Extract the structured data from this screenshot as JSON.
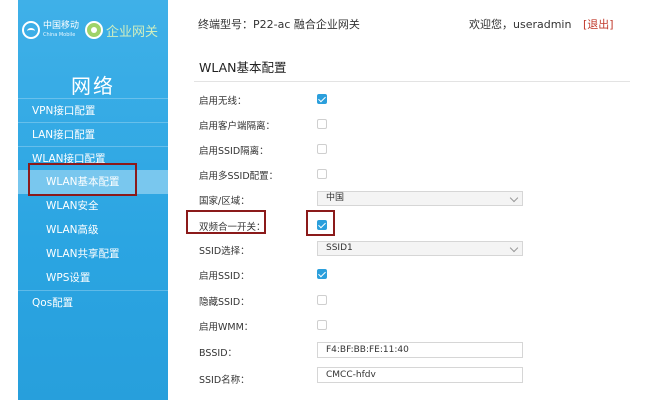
{
  "brand": {
    "cm_cn": "中国移动",
    "cm_en": "China Mobile",
    "enterprise": "企业网关"
  },
  "header": {
    "device_label": "终端型号：P22-ac 融合企业网关",
    "welcome": "欢迎您，useradmin",
    "logout": "[退出]"
  },
  "sidebar": {
    "section_title": "网络",
    "items": [
      {
        "label": "VPN接口配置"
      },
      {
        "label": "LAN接口配置"
      },
      {
        "label": "WLAN接口配置"
      },
      {
        "label": "WLAN基本配置"
      },
      {
        "label": "WLAN安全"
      },
      {
        "label": "WLAN高级"
      },
      {
        "label": "WLAN共享配置"
      },
      {
        "label": "WPS设置"
      },
      {
        "label": "Qos配置"
      }
    ]
  },
  "main": {
    "title": "WLAN基本配置",
    "fields": {
      "enable_wireless": {
        "label": "启用无线：",
        "checked": true
      },
      "client_isolation": {
        "label": "启用客户端隔离：",
        "checked": false
      },
      "ssid_isolation": {
        "label": "启用SSID隔离：",
        "checked": false
      },
      "multi_ssid": {
        "label": "启用多SSID配置：",
        "checked": false
      },
      "country": {
        "label": "国家/区域：",
        "value": "中国"
      },
      "dual_band": {
        "label": "双频合一开关：",
        "checked": true
      },
      "ssid_select": {
        "label": "SSID选择：",
        "value": "SSID1"
      },
      "enable_ssid": {
        "label": "启用SSID：",
        "checked": true
      },
      "hide_ssid": {
        "label": "隐藏SSID：",
        "checked": false
      },
      "enable_wmm": {
        "label": "启用WMM：",
        "checked": false
      },
      "bssid": {
        "label": "BSSID：",
        "value": "F4:BF:BB:FE:11:40"
      },
      "ssid_name": {
        "label": "SSID名称：",
        "value": "CMCC-hfdv"
      }
    }
  },
  "colors": {
    "sidebar": "#2ba5e2",
    "active_item": "#79c7ee",
    "checkbox_checked": "#2b9fdc",
    "highlight_box": "#8b1a1a",
    "logout": "#c0392b"
  }
}
